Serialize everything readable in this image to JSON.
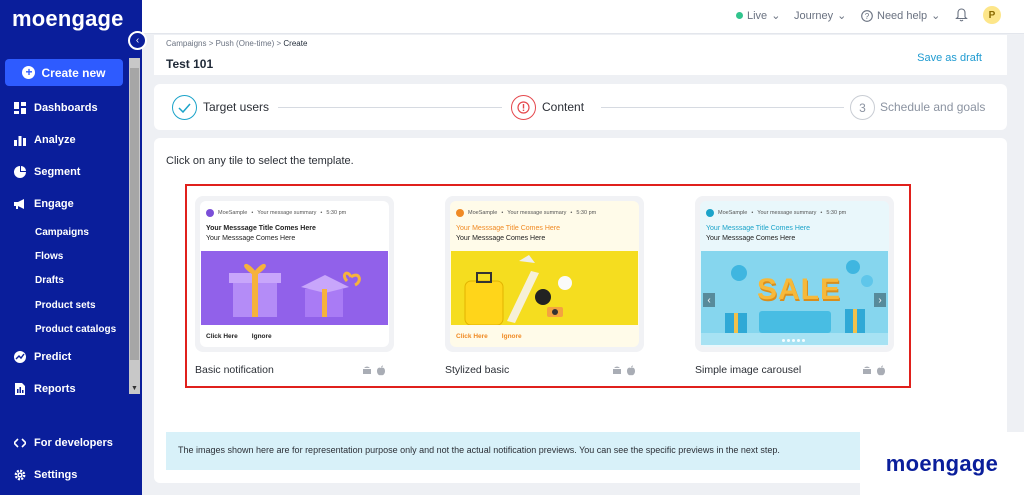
{
  "sidebar": {
    "logo": "moengage",
    "create_label": "Create new",
    "items": [
      {
        "label": "Dashboards",
        "icon": "dashboard-icon"
      },
      {
        "label": "Analyze",
        "icon": "bar-chart-icon"
      },
      {
        "label": "Segment",
        "icon": "pie-chart-icon"
      },
      {
        "label": "Engage",
        "icon": "megaphone-icon"
      }
    ],
    "engage_sub": [
      "Campaigns",
      "Flows",
      "Drafts",
      "Product sets",
      "Product catalogs"
    ],
    "items_bottom": [
      {
        "label": "Predict",
        "icon": "predict-icon"
      },
      {
        "label": "Reports",
        "icon": "report-icon"
      }
    ],
    "developers_label": "For developers",
    "settings_label": "Settings"
  },
  "topbar": {
    "live_label": "Live",
    "journey_label": "Journey",
    "help_label": "Need help",
    "avatar_initial": "P"
  },
  "header": {
    "breadcrumb_1": "Campaigns",
    "breadcrumb_2": "Push (One-time)",
    "breadcrumb_3": "Create",
    "sep": " > ",
    "title": "Test 101",
    "save_draft": "Save as draft"
  },
  "steps": [
    {
      "label": "Target users",
      "state": "done"
    },
    {
      "label": "Content",
      "state": "error"
    },
    {
      "number": "3",
      "label": "Schedule and goals",
      "state": "pending"
    }
  ],
  "content": {
    "instruction": "Click on any tile to select the template.",
    "tiles": [
      {
        "label": "Basic notification",
        "app_name": "MoeSample",
        "summary": "Your message summary",
        "time": "5:30 pm",
        "title": "Your Messsage Title Comes Here",
        "text": "Your Messsage Comes Here",
        "action_1": "Click Here",
        "action_2": "Ignore",
        "accent": "#7b4fd8"
      },
      {
        "label": "Stylized basic",
        "app_name": "MoeSample",
        "summary": "Your message summary",
        "time": "5:30 pm",
        "title": "Your Messsage Title Comes Here",
        "text": "Your Messsage Comes Here",
        "action_1": "Click Here",
        "action_2": "Ignore",
        "accent": "#f08a24"
      },
      {
        "label": "Simple image carousel",
        "app_name": "MoeSample",
        "summary": "Your message summary",
        "time": "5:30 pm",
        "title": "Your Messsage Title Comes Here",
        "text": "Your Messsage Comes Here",
        "sale_text": "SALE",
        "accent": "#1ba3c9"
      }
    ],
    "info_banner": "The images shown here are for representation purpose only and not the actual notification previews. You can see the specific previews in the next step."
  },
  "brand": {
    "logo": "moengage"
  },
  "colors": {
    "sidebar_bg": "#0a1e9b",
    "primary": "#2e5bff",
    "highlight_border": "#e0201c",
    "success": "#31c48d",
    "error": "#e5484d",
    "link": "#1f9bd1"
  }
}
